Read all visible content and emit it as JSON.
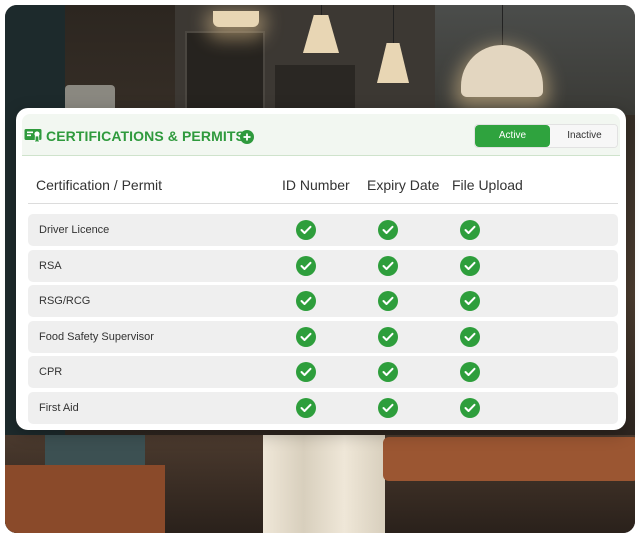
{
  "header": {
    "title": "CERTIFICATIONS & PERMITS",
    "toggle": {
      "active_label": "Active",
      "inactive_label": "Inactive",
      "selected": "Active"
    }
  },
  "table": {
    "columns": [
      "Certification / Permit",
      "ID Number",
      "Expiry Date",
      "File Upload"
    ],
    "rows": [
      {
        "label": "Driver Licence",
        "id_number": true,
        "expiry_date": true,
        "file_upload": true
      },
      {
        "label": "RSA",
        "id_number": true,
        "expiry_date": true,
        "file_upload": true
      },
      {
        "label": "RSG/RCG",
        "id_number": true,
        "expiry_date": true,
        "file_upload": true
      },
      {
        "label": "Food Safety Supervisor",
        "id_number": true,
        "expiry_date": true,
        "file_upload": true
      },
      {
        "label": "CPR",
        "id_number": true,
        "expiry_date": true,
        "file_upload": true
      },
      {
        "label": "First Aid",
        "id_number": true,
        "expiry_date": true,
        "file_upload": true
      }
    ]
  },
  "colors": {
    "accent": "#2fa33e",
    "check": "#2e9e3c",
    "header_bg": "#f2f7f1",
    "row_bg": "#efefef"
  },
  "icons": {
    "header": "certificate-icon",
    "add": "plus-circle-icon",
    "status": "check-circle-icon"
  }
}
